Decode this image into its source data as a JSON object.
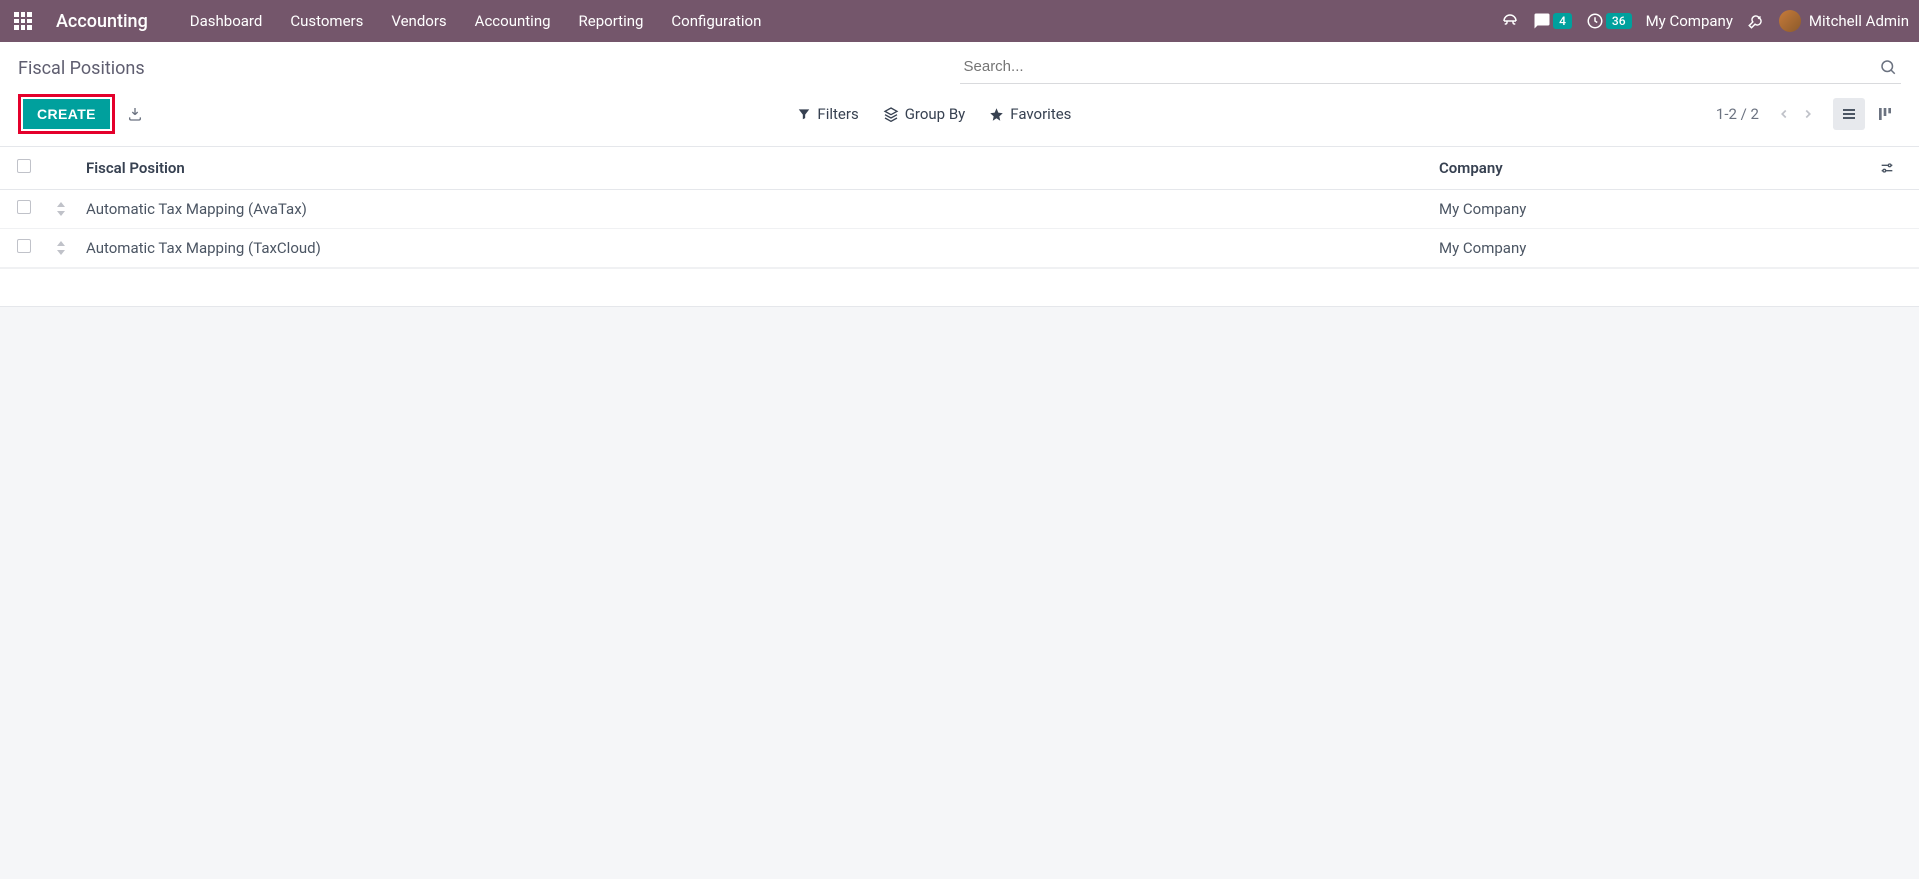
{
  "nav": {
    "app_title": "Accounting",
    "menu": [
      "Dashboard",
      "Customers",
      "Vendors",
      "Accounting",
      "Reporting",
      "Configuration"
    ],
    "messages_badge": "4",
    "activities_badge": "36",
    "company": "My Company",
    "user": "Mitchell Admin"
  },
  "breadcrumb": "Fiscal Positions",
  "search": {
    "placeholder": "Search..."
  },
  "buttons": {
    "create": "CREATE",
    "filters": "Filters",
    "groupby": "Group By",
    "favorites": "Favorites"
  },
  "pager": "1-2 / 2",
  "table": {
    "headers": {
      "name": "Fiscal Position",
      "company": "Company"
    },
    "rows": [
      {
        "name": "Automatic Tax Mapping (AvaTax)",
        "company": "My Company"
      },
      {
        "name": "Automatic Tax Mapping (TaxCloud)",
        "company": "My Company"
      }
    ]
  }
}
